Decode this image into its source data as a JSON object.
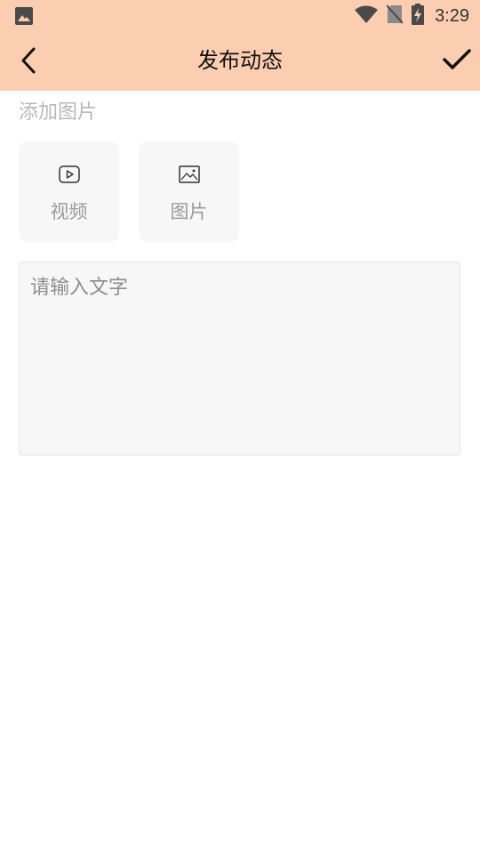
{
  "status_bar": {
    "time": "3:29",
    "icons": [
      "gallery-icon",
      "wifi-icon",
      "no-sim-icon",
      "battery-charging-icon"
    ]
  },
  "app_bar": {
    "title": "发布动态",
    "back_icon": "chevron-left-icon",
    "confirm_icon": "checkmark-icon"
  },
  "media": {
    "section_label": "添加图片",
    "tiles": [
      {
        "label": "视频",
        "icon": "video-play-icon"
      },
      {
        "label": "图片",
        "icon": "image-icon"
      }
    ]
  },
  "editor": {
    "value": "",
    "placeholder": "请输入文字"
  },
  "colors": {
    "header_bg": "#FBCEB1",
    "tile_bg": "#F7F7F7",
    "label_gray": "#9A9A9A"
  }
}
